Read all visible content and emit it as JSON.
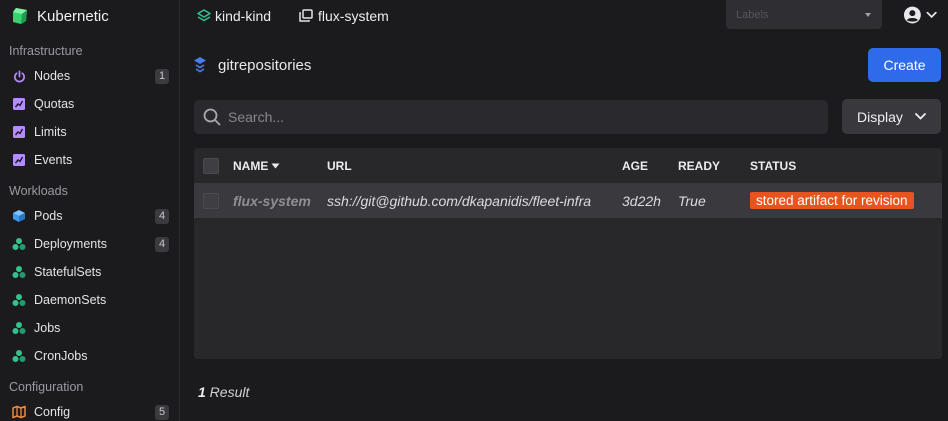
{
  "colors": {
    "accent": "#2d6bea",
    "status_error": "#e8541f",
    "brand": "#3bd16f",
    "icon_purple": "#b58bff",
    "icon_blue": "#3d9be9",
    "icon_green": "#33c28a",
    "icon_orange": "#ef8a3b"
  },
  "app": {
    "name": "Kubernetic"
  },
  "sidebar": {
    "sections": [
      {
        "title": "Infrastructure"
      },
      {
        "title": "Workloads"
      },
      {
        "title": "Configuration"
      }
    ],
    "items": [
      {
        "label": "Nodes",
        "icon": "power-icon",
        "badge": "1"
      },
      {
        "label": "Quotas",
        "icon": "chart-icon",
        "badge": ""
      },
      {
        "label": "Limits",
        "icon": "chart-icon",
        "badge": ""
      },
      {
        "label": "Events",
        "icon": "chart-icon",
        "badge": ""
      },
      {
        "label": "Pods",
        "icon": "cube-icon",
        "badge": "4"
      },
      {
        "label": "Deployments",
        "icon": "cubes-icon",
        "badge": "4"
      },
      {
        "label": "StatefulSets",
        "icon": "cubes-icon",
        "badge": ""
      },
      {
        "label": "DaemonSets",
        "icon": "cubes-icon",
        "badge": ""
      },
      {
        "label": "Jobs",
        "icon": "cubes-icon",
        "badge": ""
      },
      {
        "label": "CronJobs",
        "icon": "cubes-icon",
        "badge": ""
      },
      {
        "label": "Config",
        "icon": "map-icon",
        "badge": "5"
      }
    ]
  },
  "topbar": {
    "cluster": "kind-kind",
    "namespace": "flux-system",
    "labels_placeholder": "Labels"
  },
  "page": {
    "title": "gitrepositories",
    "create_label": "Create"
  },
  "search": {
    "placeholder": "Search..."
  },
  "display": {
    "label": "Display"
  },
  "table": {
    "columns": [
      "NAME",
      "URL",
      "AGE",
      "READY",
      "STATUS"
    ],
    "sorted_column": "NAME",
    "rows": [
      {
        "name": "flux-system",
        "url": "ssh://git@github.com/dkapanidis/fleet-infra",
        "age": "3d22h",
        "ready": "True",
        "status": "stored artifact for revision"
      }
    ]
  },
  "footer": {
    "count": "1",
    "suffix": " Result"
  }
}
